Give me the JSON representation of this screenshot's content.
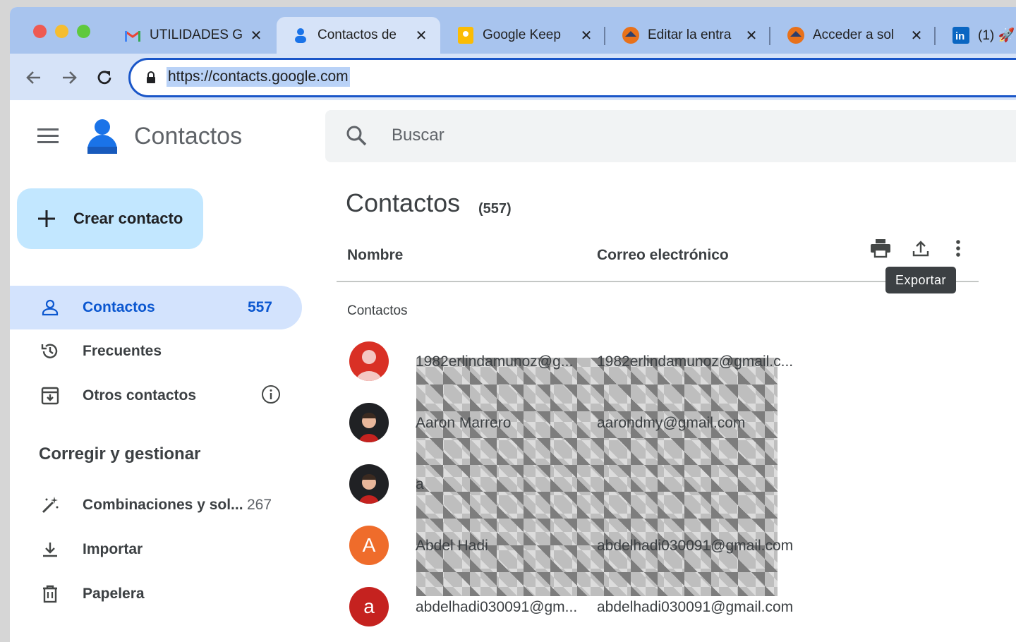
{
  "browser": {
    "tabs": [
      {
        "title": "UTILIDADES G",
        "icon": "gmail-icon"
      },
      {
        "title": "Contactos de",
        "icon": "contacts-icon"
      },
      {
        "title": "Google Keep",
        "icon": "keep-icon"
      },
      {
        "title": "Editar la entra",
        "icon": "site-icon"
      },
      {
        "title": "Acceder a sol",
        "icon": "site-icon"
      },
      {
        "title": "(1) 🚀",
        "icon": "linkedin-icon"
      }
    ],
    "url": "https://contacts.google.com"
  },
  "app": {
    "name": "Contactos",
    "search_placeholder": "Buscar",
    "create_label": "Crear contacto"
  },
  "sidebar": {
    "items": [
      {
        "label": "Contactos",
        "count": "557"
      },
      {
        "label": "Frecuentes"
      },
      {
        "label": "Otros contactos"
      }
    ],
    "section_title": "Corregir y gestionar",
    "manage": [
      {
        "label": "Combinaciones y sol...",
        "count": "267"
      },
      {
        "label": "Importar"
      },
      {
        "label": "Papelera"
      }
    ]
  },
  "main": {
    "title": "Contactos",
    "count": "(557)",
    "col_name": "Nombre",
    "col_email": "Correo electrónico",
    "tooltip": "Exportar",
    "group_label": "Contactos",
    "rows": [
      {
        "name": "1982erlindamunoz@g...",
        "email": "1982erlindamunoz@gmail.c...",
        "avatar_color": "#d93025",
        "letter": ""
      },
      {
        "name": "Aaron Marrero",
        "email": "aarondmy@gmail.com",
        "avatar_color": "#202124",
        "letter": ""
      },
      {
        "name": "a",
        "email": "",
        "avatar_color": "#202124",
        "letter": ""
      },
      {
        "name": "Abdel Hadi",
        "email": "abdelhadi030091@gmail.com",
        "avatar_color": "#ef6c2b",
        "letter": "A"
      },
      {
        "name": "abdelhadi030091@gm...",
        "email": "abdelhadi030091@gmail.com",
        "avatar_color": "#c5221f",
        "letter": "a"
      }
    ]
  }
}
